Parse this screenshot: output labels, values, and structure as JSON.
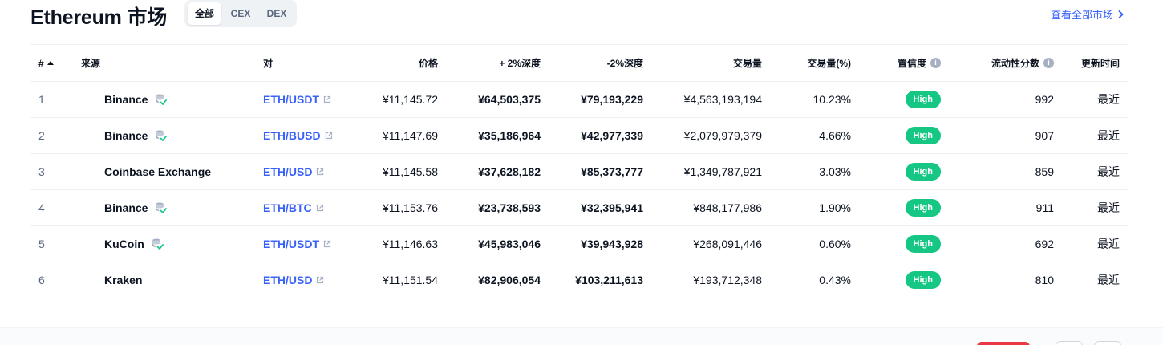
{
  "header": {
    "title": "Ethereum 市场",
    "tabs": [
      {
        "label": "全部",
        "active": true
      },
      {
        "label": "CEX",
        "active": false
      },
      {
        "label": "DEX",
        "active": false
      }
    ],
    "view_all": "查看全部市场"
  },
  "table": {
    "columns": {
      "rank": "#",
      "source": "来源",
      "pair": "对",
      "price": "价格",
      "plus_depth": "+ 2%深度",
      "minus_depth": "-2%深度",
      "volume": "交易量",
      "volume_pct": "交易量(%)",
      "confidence": "置信度",
      "liquidity": "流动性分数",
      "updated": "更新时间"
    },
    "rows": [
      {
        "rank": "1",
        "source": "Binance",
        "verified": true,
        "pair": "ETH/USDT",
        "price": "¥11,145.72",
        "plus_depth": "¥64,503,375",
        "minus_depth": "¥79,193,229",
        "volume": "¥4,563,193,194",
        "volume_pct": "10.23%",
        "confidence": "High",
        "liquidity": "992",
        "updated": "最近"
      },
      {
        "rank": "2",
        "source": "Binance",
        "verified": true,
        "pair": "ETH/BUSD",
        "price": "¥11,147.69",
        "plus_depth": "¥35,186,964",
        "minus_depth": "¥42,977,339",
        "volume": "¥2,079,979,379",
        "volume_pct": "4.66%",
        "confidence": "High",
        "liquidity": "907",
        "updated": "最近"
      },
      {
        "rank": "3",
        "source": "Coinbase Exchange",
        "verified": false,
        "pair": "ETH/USD",
        "price": "¥11,145.58",
        "plus_depth": "¥37,628,182",
        "minus_depth": "¥85,373,777",
        "volume": "¥1,349,787,921",
        "volume_pct": "3.03%",
        "confidence": "High",
        "liquidity": "859",
        "updated": "最近"
      },
      {
        "rank": "4",
        "source": "Binance",
        "verified": true,
        "pair": "ETH/BTC",
        "price": "¥11,153.76",
        "plus_depth": "¥23,738,593",
        "minus_depth": "¥32,395,941",
        "volume": "¥848,177,986",
        "volume_pct": "1.90%",
        "confidence": "High",
        "liquidity": "911",
        "updated": "最近"
      },
      {
        "rank": "5",
        "source": "KuCoin",
        "verified": true,
        "pair": "ETH/USDT",
        "price": "¥11,146.63",
        "plus_depth": "¥45,983,046",
        "minus_depth": "¥39,943,928",
        "volume": "¥268,091,446",
        "volume_pct": "0.60%",
        "confidence": "High",
        "liquidity": "692",
        "updated": "最近"
      },
      {
        "rank": "6",
        "source": "Kraken",
        "verified": false,
        "pair": "ETH/USD",
        "price": "¥11,151.54",
        "plus_depth": "¥82,906,054",
        "minus_depth": "¥103,211,613",
        "volume": "¥193,712,348",
        "volume_pct": "0.43%",
        "confidence": "High",
        "liquidity": "810",
        "updated": "最近"
      }
    ]
  },
  "colors": {
    "link": "#3861fb",
    "confidence_high": "#16c784",
    "text": "#0d1421",
    "muted": "#58667e"
  }
}
